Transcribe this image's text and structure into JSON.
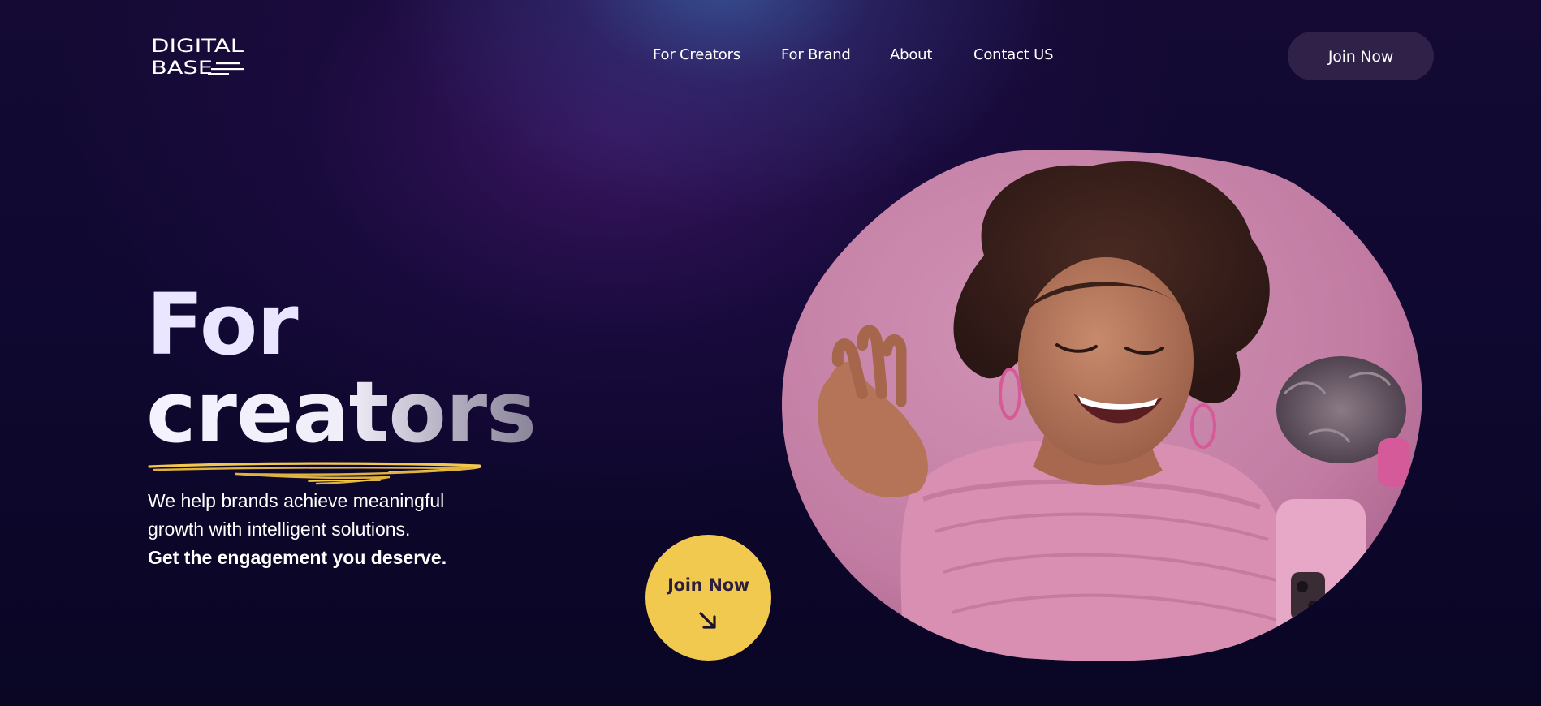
{
  "brand": {
    "logo_line_1": "DIGITAL",
    "logo_line_2": "BASE",
    "logo_icon": "digital-base-logo"
  },
  "nav": {
    "items": [
      {
        "label": "For Creators"
      },
      {
        "label": "For Brand"
      },
      {
        "label": "About"
      },
      {
        "label": "Contact US"
      }
    ]
  },
  "header": {
    "join_label": "Join Now"
  },
  "hero": {
    "title_line_1": "For",
    "title_line_2": "creators",
    "subtitle_line_1": "We help brands achieve meaningful",
    "subtitle_line_2": "growth with intelligent solutions.",
    "subtitle_bold": "Get the engagement you deserve.",
    "cta_label": "Join Now",
    "cta_icon": "arrow-down-right-icon",
    "image_icon": "creator-photo"
  },
  "colors": {
    "accent_yellow": "#f2c94f",
    "background": "#0f0830",
    "photo_tint": "#c97ba4",
    "pill_button": "#2f2148"
  }
}
